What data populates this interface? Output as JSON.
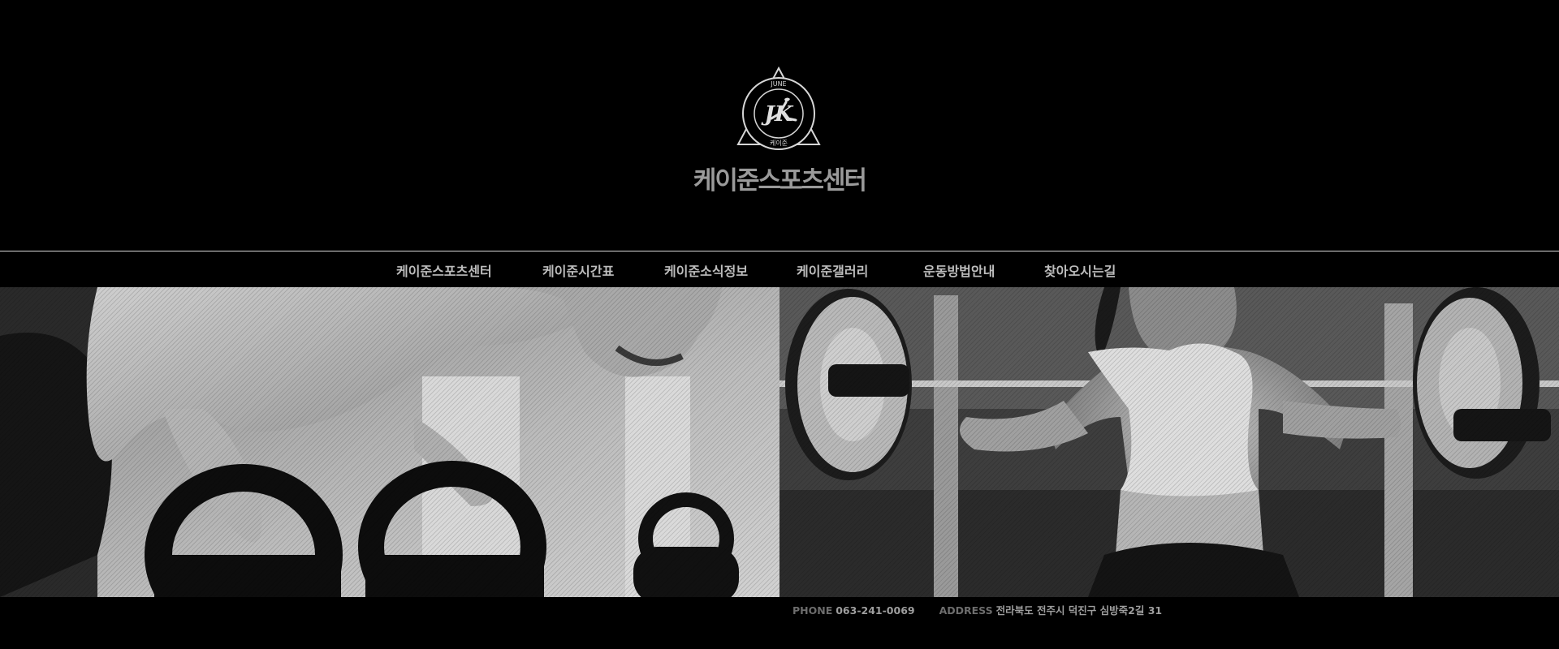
{
  "header": {
    "logo": {
      "top_text": "JUNE",
      "monogram": "JK",
      "bottom_text": "케이준",
      "icon": "runner-logo-icon"
    },
    "site_title": "케이준스포츠센터"
  },
  "nav": {
    "items": [
      {
        "label": "케이준스포츠센터"
      },
      {
        "label": "케이준시간표"
      },
      {
        "label": "케이준소식정보"
      },
      {
        "label": "케이준갤러리"
      },
      {
        "label": "운동방법안내"
      },
      {
        "label": "찾아오시는길"
      }
    ]
  },
  "hero": {
    "left_image": "man-pushup-kettlebells-photo",
    "right_image": "woman-barbell-squat-photo"
  },
  "footer": {
    "phone_label": "PHONE",
    "phone": "063-241-0069",
    "address_label": "ADDRESS",
    "address": "전라북도 전주시 덕진구 심방죽2길 31"
  },
  "colors": {
    "background": "#000000",
    "nav_text": "#bdbdbd",
    "title_text": "#9a9a9a",
    "divider": "#d8d8d8"
  }
}
